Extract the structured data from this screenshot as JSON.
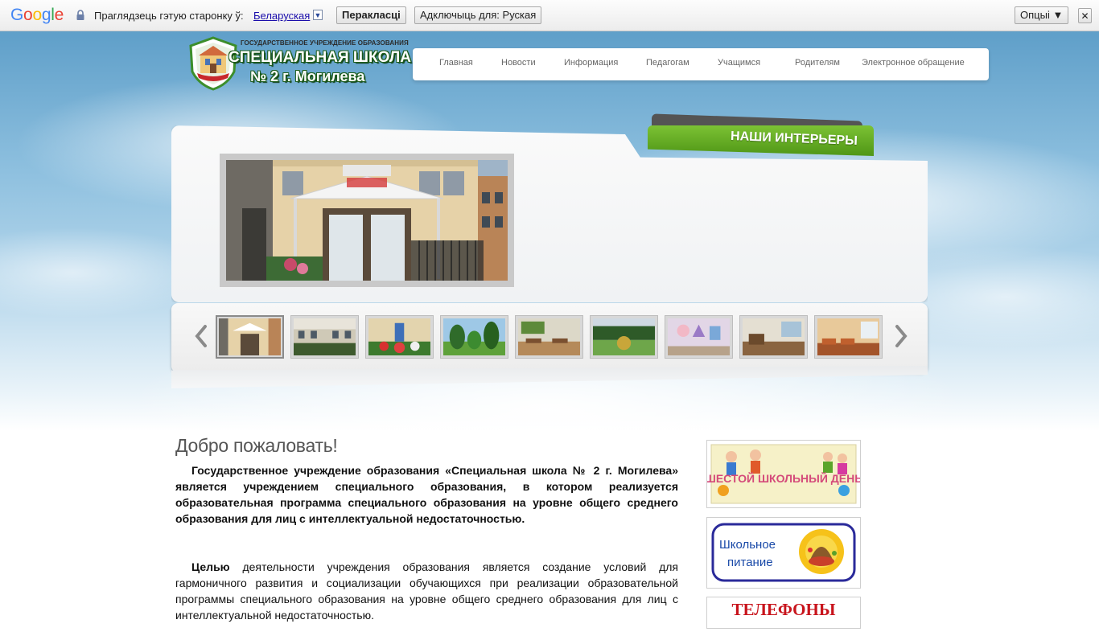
{
  "translate_bar": {
    "logo": "Google",
    "prompt": "Праглядзець гэтую старонку ў:",
    "language": "Беларуская",
    "translate_button": "Перакласці",
    "turn_off_button": "Адключыць для: Руская",
    "options_button": "Опцыі ▼",
    "close_symbol": "✕"
  },
  "logo": {
    "line1": "ГОСУДАРСТВЕННОЕ УЧРЕЖДЕНИЕ ОБРАЗОВАНИЯ",
    "line2": "СПЕЦИАЛЬНАЯ ШКОЛА",
    "line3": "№ 2  г. Могилева"
  },
  "nav": [
    "Главная",
    "Новости",
    "Информация",
    "Педагогам",
    "Учащимся",
    "Родителям",
    "Электронное обращение"
  ],
  "slider": {
    "tab_title": "НАШИ ИНТЕРЬЕРЫ",
    "main_photo_sign": "РЕВЕЙМЕЙ ТЭУЭН",
    "thumbnails": [
      "school-entrance",
      "school-facade",
      "flower-sculpture",
      "garden-shrubs",
      "classroom-1",
      "courtyard-flowerbed",
      "mural-wall",
      "classroom-2",
      "classroom-3"
    ],
    "active_index": 0
  },
  "content": {
    "heading": "Добро пожаловать!",
    "p1": "Государственное учреждение образования «Специальная школа № 2  г. Могилева» является учреждением специального образования, в котором реализуется образовательная программа специального образования на уровне общего среднего образования для лиц с интеллектуальной недостаточностью.",
    "p2_bold": "Целью",
    "p2_rest": " деятельности учреждения образования является создание условий для гармоничного развития и социализации обучающихся при реализации образовательной программы специального образования на уровне общего среднего образования для лиц с интеллектуальной недостаточностью."
  },
  "sidebar": {
    "banner1": "ШЕСТОЙ ШКОЛЬНЫЙ ДЕНЬ",
    "banner2_line1": "Школьное",
    "banner2_line2": "питание",
    "banner3": "ТЕЛЕФОНЫ"
  },
  "colors": {
    "accent_green": "#5aa51e",
    "nav_text": "#666666",
    "link_blue": "#1a0dab"
  }
}
